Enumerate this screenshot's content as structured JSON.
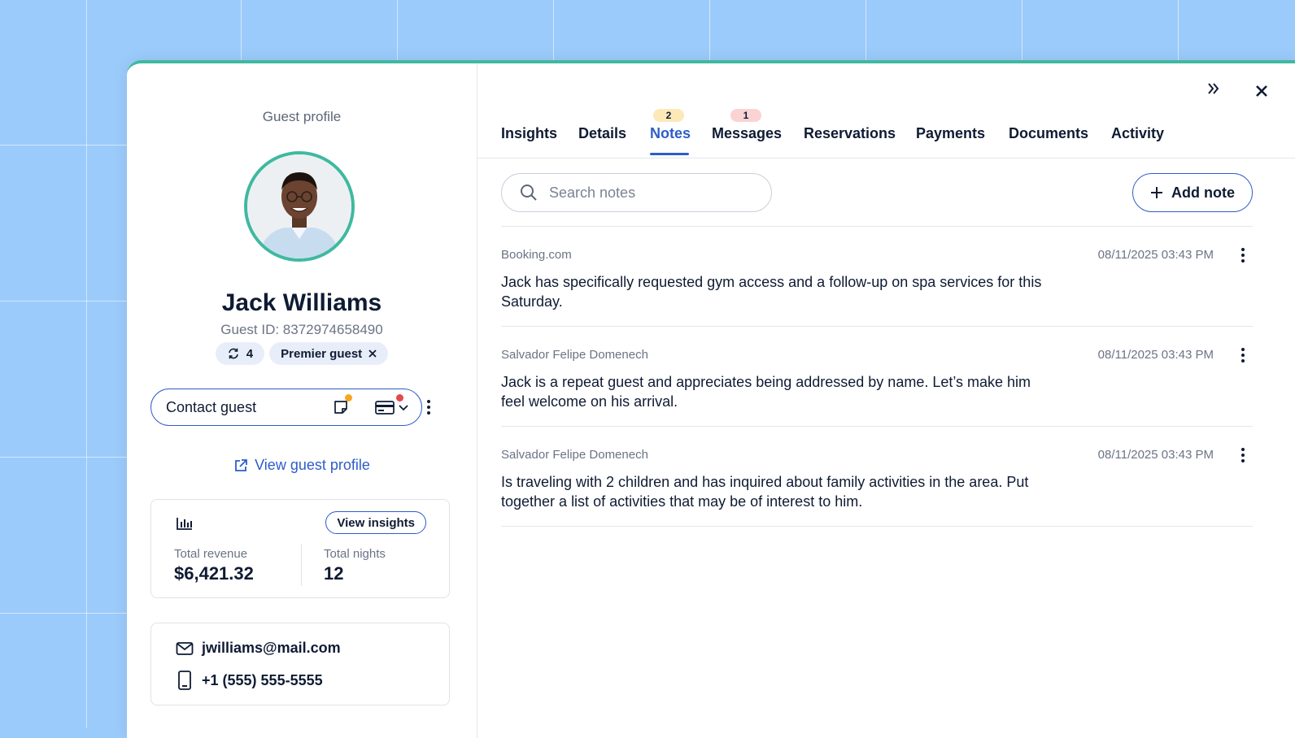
{
  "colors": {
    "background": "#9bcbfb",
    "accent": "#3fb9a0",
    "primary": "#2e5dc9",
    "text": "#0f1b33",
    "notes_badge": "#fde9b8",
    "messages_badge": "#fbd3d3",
    "dot_orange": "#f6a623",
    "dot_red": "#e5484d"
  },
  "profile": {
    "heading": "Guest profile",
    "avatar_icon": "guest-photo",
    "name": "Jack Williams",
    "guest_id": "Guest ID: 8372974658490",
    "stays_count": "4",
    "tag": "Premier guest",
    "contact_button": "Contact guest",
    "view_profile": "View guest profile"
  },
  "insights_card": {
    "button": "View insights",
    "revenue_label": "Total revenue",
    "revenue_value": "$6,421.32",
    "nights_label": "Total nights",
    "nights_value": "12"
  },
  "contact_card": {
    "email": "jwilliams@mail.com",
    "phone": "+1 (555) 555-5555"
  },
  "tabs": [
    {
      "label": "Insights",
      "badge": ""
    },
    {
      "label": "Details",
      "badge": ""
    },
    {
      "label": "Notes",
      "badge": "2"
    },
    {
      "label": "Messages",
      "badge": "1"
    },
    {
      "label": "Reservations",
      "badge": ""
    },
    {
      "label": "Payments",
      "badge": ""
    },
    {
      "label": "Documents",
      "badge": ""
    },
    {
      "label": "Activity",
      "badge": ""
    }
  ],
  "active_tab": "Notes",
  "notes_toolbar": {
    "search_placeholder": "Search notes",
    "add_label": "Add note"
  },
  "notes": [
    {
      "source": "Booking.com",
      "date": "08/11/2025 03:43 PM",
      "text": "Jack has specifically requested gym access and a follow-up on spa services for this Saturday."
    },
    {
      "source": "Salvador Felipe Domenech",
      "date": "08/11/2025 03:43 PM",
      "text": "Jack is a repeat guest and appreciates being addressed by name. Let’s make him feel welcome on his arrival."
    },
    {
      "source": "Salvador Felipe Domenech",
      "date": "08/11/2025 03:43 PM",
      "text": "Is traveling with 2 children and has inquired about family activities in the area. Put together a list of activities that may be of interest to him."
    }
  ]
}
